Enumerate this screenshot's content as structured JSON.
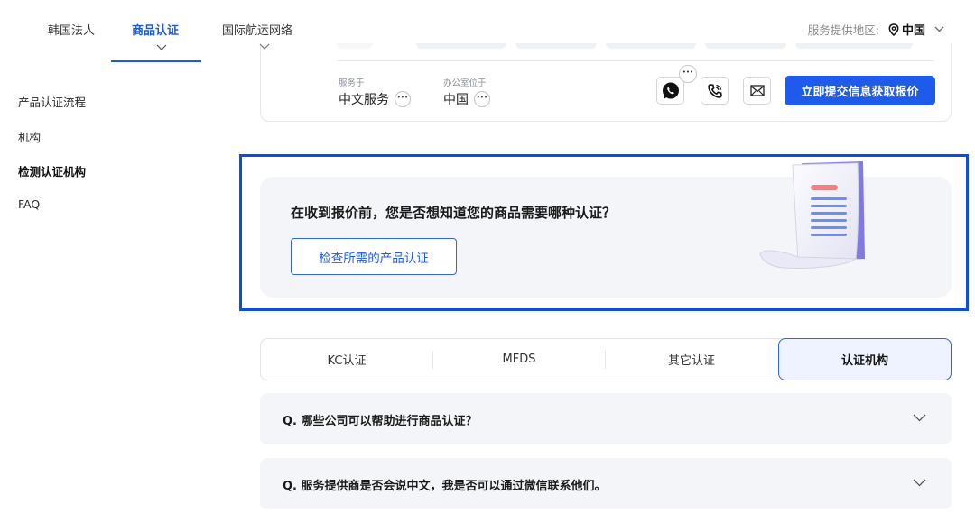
{
  "topnav": {
    "tabs": [
      {
        "label": "韩国法人"
      },
      {
        "label": "商品认证"
      },
      {
        "label": "国际航运网络"
      }
    ],
    "region_label": "服务提供地区:",
    "region_value": "中国"
  },
  "sidebar": {
    "items": [
      {
        "label": "产品认证流程"
      },
      {
        "label": "机构"
      },
      {
        "label": "检测认证机构"
      },
      {
        "label": "FAQ"
      }
    ]
  },
  "provider": {
    "service_label": "服务于",
    "service_value": "中文服务",
    "office_label": "办公室位于",
    "office_value": "中国",
    "quote_button": "立即提交信息获取报价"
  },
  "banner": {
    "question": "在收到报价前，您是否想知道您的商品需要哪种认证？",
    "button": "检查所需的产品认证"
  },
  "cert_tabs": [
    {
      "label": "KC认证"
    },
    {
      "label": "MFDS"
    },
    {
      "label": "其它认证"
    },
    {
      "label": "认证机构"
    }
  ],
  "faq": [
    {
      "question": "Q. 哪些公司可以帮助进行商品认证？"
    },
    {
      "question": "Q. 服务提供商是否会说中文，我是否可以通过微信联系他们。"
    }
  ],
  "colors": {
    "accent": "#1f5bea",
    "highlight_border": "#0a4fe0",
    "banner_bg": "#f4f5f9"
  }
}
